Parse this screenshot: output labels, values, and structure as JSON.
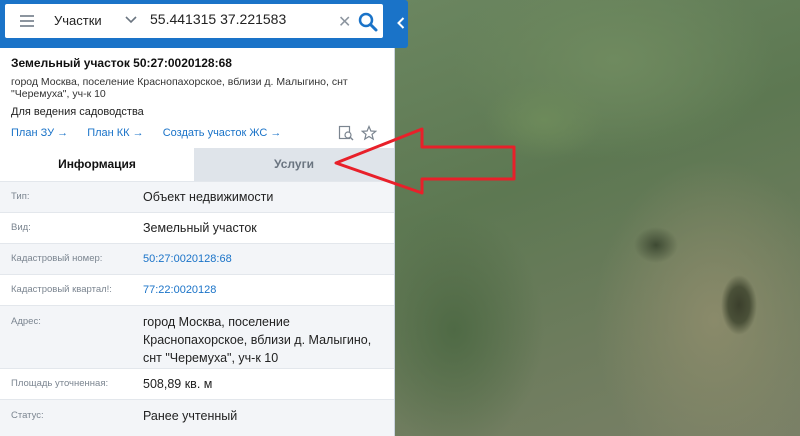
{
  "search": {
    "type_label": "Участки",
    "query": "55.441315 37.221583",
    "clear_symbol": "✕"
  },
  "parcel": {
    "title": "Земельный участок 50:27:0020128:68",
    "address_sub": "город Москва, поселение Краснопахорское, вблизи д. Малыгино, снт \"Черемуха\", уч-к 10",
    "purpose": "Для ведения садоводства"
  },
  "links": {
    "plan_zu": "План ЗУ →",
    "plan_kk": "План КК →",
    "create": "Создать участок ЖС →"
  },
  "tabs": {
    "info": "Информация",
    "services": "Услуги"
  },
  "rows": [
    {
      "label": "Тип:",
      "value": "Объект недвижимости"
    },
    {
      "label": "Вид:",
      "value": "Земельный участок"
    },
    {
      "label": "Кадастровый номер:",
      "value": "50:27:0020128:68"
    },
    {
      "label": "Кадастровый квартал!:",
      "value": "77:22:0020128"
    },
    {
      "label": "Адрес:",
      "value": "город Москва, поселение Краснопахорское, вблизи д. Малыгино, снт \"Черемуха\", уч-к 10"
    },
    {
      "label": "Площадь уточненная:",
      "value": "508,89 кв. м"
    },
    {
      "label": "Статус:",
      "value": "Ранее учтенный"
    }
  ],
  "icons": [
    "hamburger-icon",
    "chevron-down-icon",
    "search-icon",
    "close-icon",
    "chevron-left-icon",
    "map-search-icon",
    "star-icon",
    "arrow-annotation"
  ],
  "colors": {
    "brand": "#1a73c8",
    "annotation": "#e8202a"
  }
}
